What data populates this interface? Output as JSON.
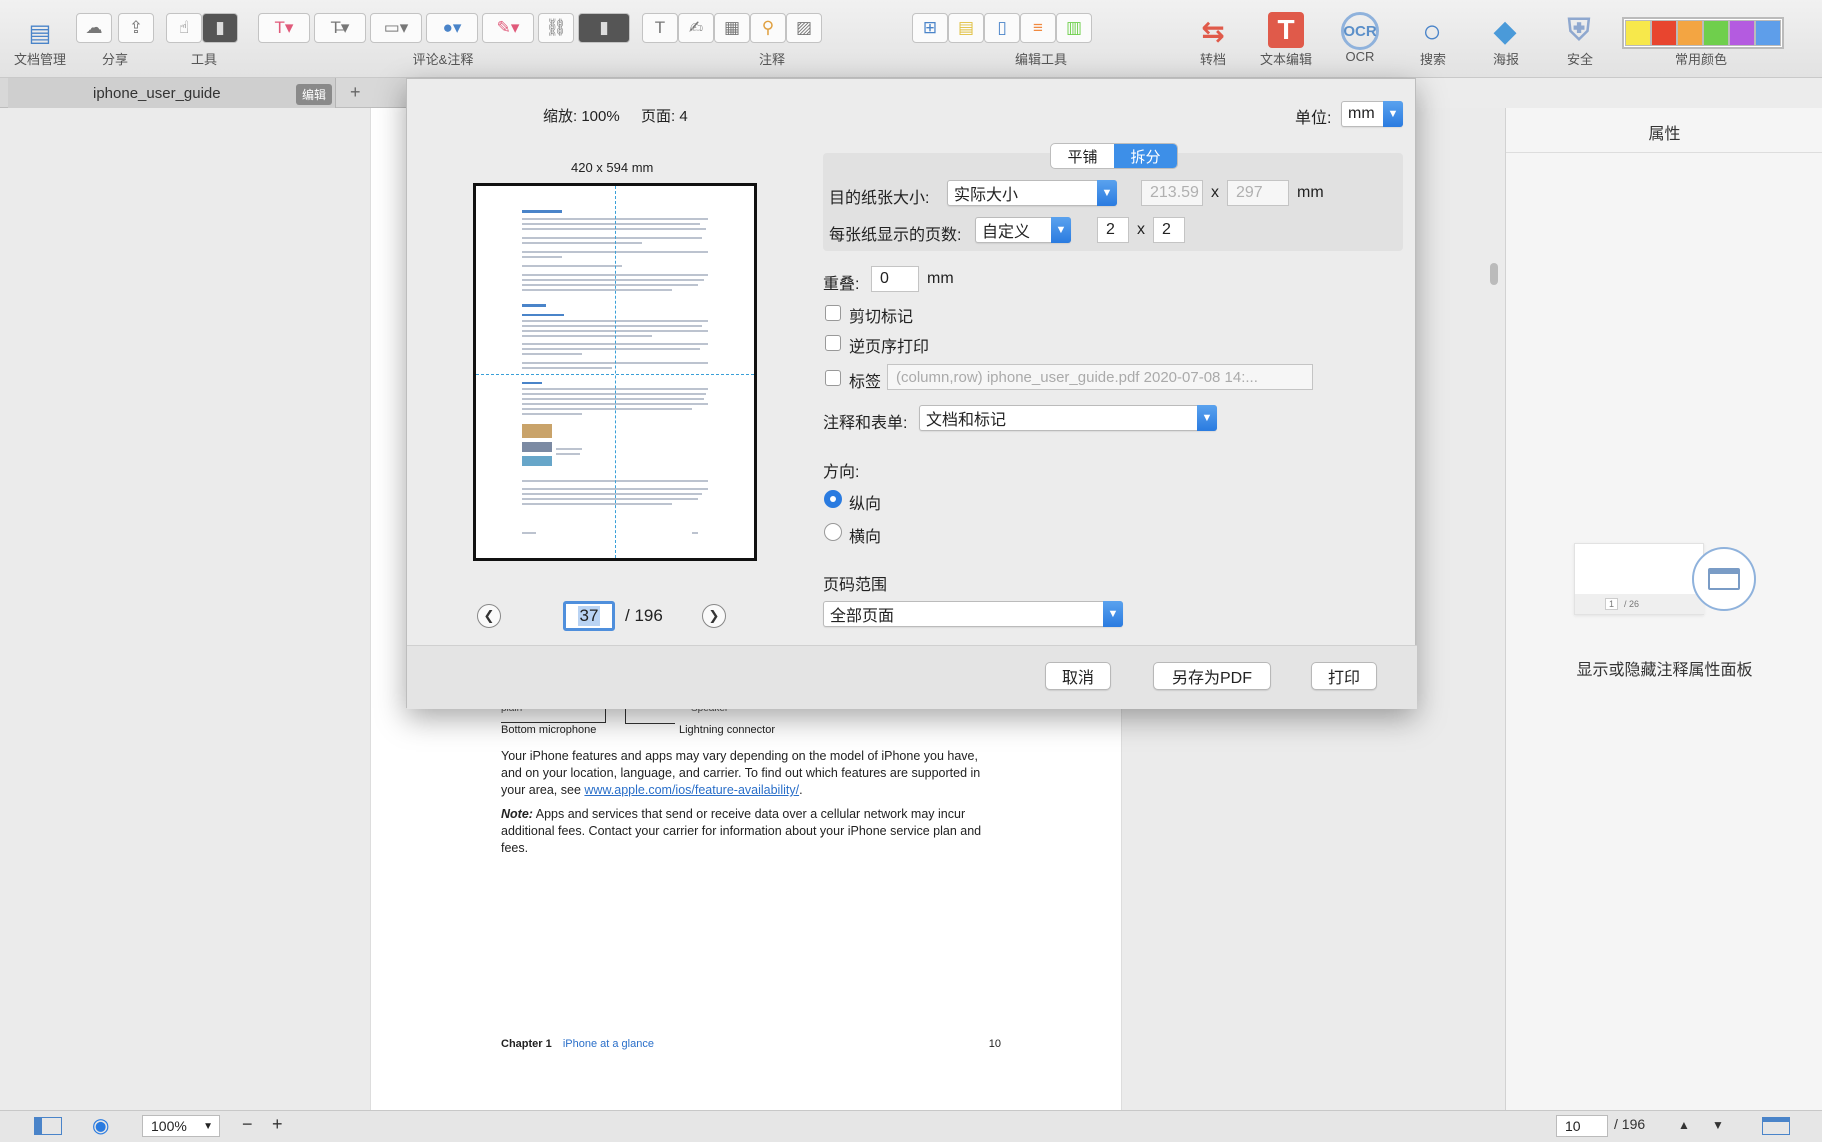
{
  "toolbar": {
    "groups": {
      "doc_manage": "文档管理",
      "share": "分享",
      "tools": "工具",
      "comment_annot": "评论&注释",
      "annot": "注释",
      "edit_tools": "编辑工具",
      "convert": "转档",
      "text_edit": "文本编辑",
      "ocr": "OCR",
      "search": "搜索",
      "poster": "海报",
      "security": "安全",
      "common_colors": "常用颜色"
    },
    "ocr_icon_text": "OCR",
    "text_edit_icon_text": "T",
    "colors": [
      "#f7e84b",
      "#e8452f",
      "#f3a542",
      "#6fcf4c",
      "#b45be0",
      "#5e9eea"
    ]
  },
  "tab": {
    "name": "iphone_user_guide",
    "edit_badge": "编辑",
    "add": "+"
  },
  "document": {
    "fig_left": "Bottom microphone",
    "fig_right": "Lightning connector",
    "fig_top_left": "plain",
    "fig_top_right": "Speaker",
    "para1_a": "Your iPhone features and apps may vary depending on the model of iPhone you have, and on your location, language, and carrier. To find out which features are supported in your area, see",
    "para1_link": "www.apple.com/ios/feature-availability/",
    "para1_end": ".",
    "note_label": "Note:",
    "note_text": " Apps and services that send or receive data over a cellular network may incur additional fees. Contact your carrier for information about your iPhone service plan and fees.",
    "footer_chapter": "Chapter 1",
    "footer_title": "iPhone at a glance",
    "footer_page": "10"
  },
  "right_panel": {
    "title": "属性",
    "caption": "显示或隐藏注释属性面板",
    "illus_page": "1",
    "illus_total": "/ 26"
  },
  "dialog": {
    "zoom": "缩放: 100%",
    "pages": "页面: 4",
    "paper_dims": "420 x 594 mm",
    "unit_label": "单位:",
    "unit_value": "mm",
    "tab_tile": "平铺",
    "tab_split": "拆分",
    "target_size_label": "目的纸张大小:",
    "target_size_value": "实际大小",
    "width": "213.59",
    "x1": "x",
    "height": "297",
    "mm1": "mm",
    "pages_per_sheet_label": "每张纸显示的页数:",
    "pages_per_sheet_value": "自定义",
    "cols": "2",
    "x2": "x",
    "rows": "2",
    "overlap_label": "重叠:",
    "overlap_value": "0",
    "mm2": "mm",
    "cut_marks": "剪切标记",
    "reverse": "逆页序打印",
    "labels": "标签",
    "label_placeholder": "(column,row) iphone_user_guide.pdf 2020-07-08 14:...",
    "annot_label": "注释和表单:",
    "annot_value": "文档和标记",
    "orientation_label": "方向:",
    "portrait": "纵向",
    "landscape": "横向",
    "range_label": "页码范围",
    "range_value": "全部页面",
    "current_page": "37",
    "total_pages": "/ 196",
    "cancel": "取消",
    "save_pdf": "另存为PDF",
    "print": "打印"
  },
  "statusbar": {
    "zoom": "100%",
    "minus": "−",
    "plus": "+",
    "page": "10",
    "total": "/ 196"
  }
}
